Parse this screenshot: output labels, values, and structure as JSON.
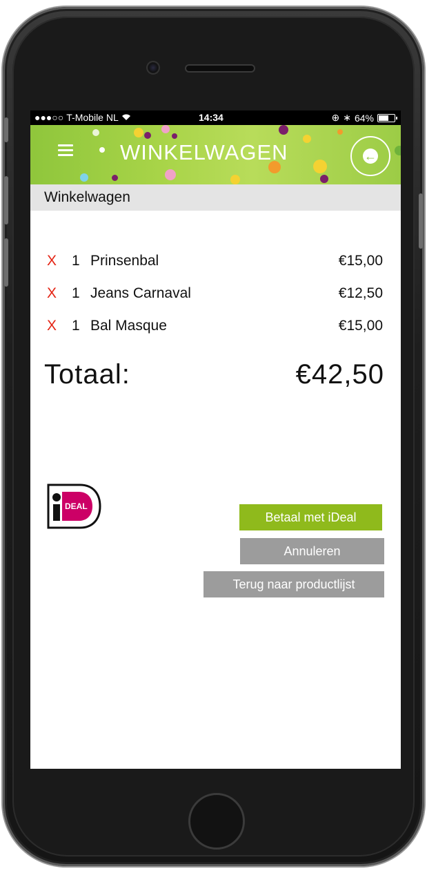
{
  "status_bar": {
    "carrier": "T-Mobile NL",
    "time": "14:34",
    "battery": "64%",
    "battery_level": 0.64
  },
  "header": {
    "title": "WINKELWAGEN",
    "menu_icon": "hamburger-menu-icon",
    "back_icon": "arrow-left-icon",
    "accent": "#8fc63c"
  },
  "section": {
    "title": "Winkelwagen"
  },
  "cart": {
    "remove_symbol": "X",
    "items": [
      {
        "qty": "1",
        "name": "Prinsenbal",
        "price": "€15,00"
      },
      {
        "qty": "1",
        "name": "Jeans Carnaval",
        "price": "€12,50"
      },
      {
        "qty": "1",
        "name": "Bal Masque",
        "price": "€15,00"
      }
    ],
    "total_label": "Totaal:",
    "total_value": "€42,50"
  },
  "payment": {
    "logo_text": "iDEAL",
    "pay_button": "Betaal met iDeal",
    "cancel_button": "Annuleren",
    "back_button": "Terug naar productlijst",
    "pay_color": "#8fba1c",
    "secondary_color": "#9c9c9c"
  }
}
